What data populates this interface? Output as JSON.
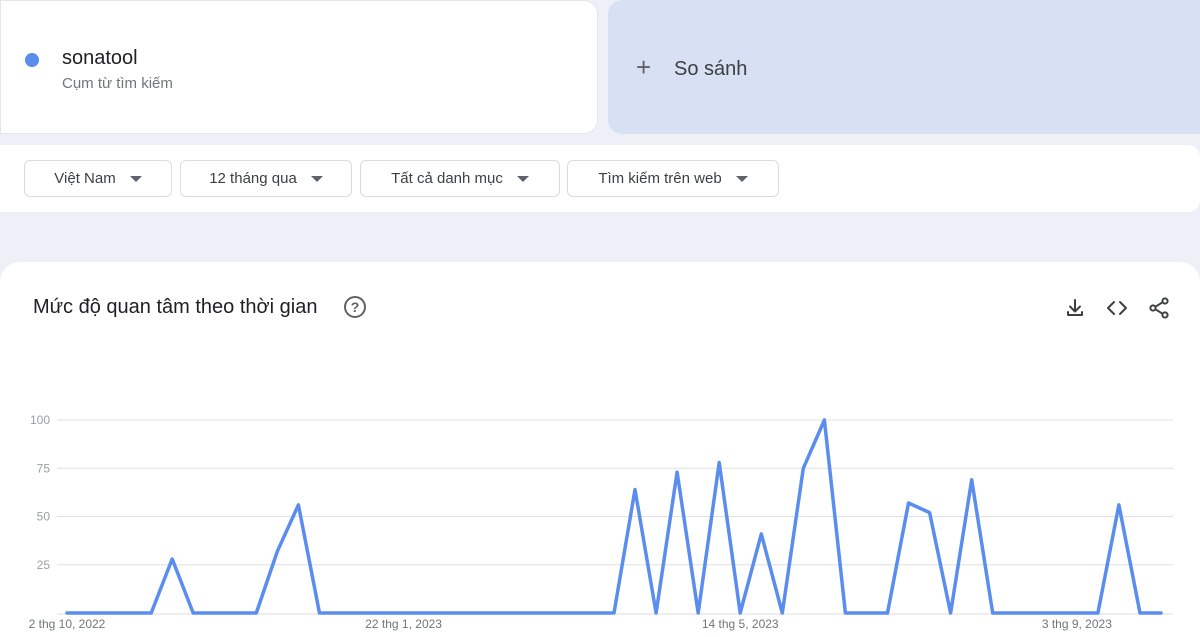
{
  "term": {
    "name": "sonatool",
    "type": "Cụm từ tìm kiếm",
    "color": "#5b8def"
  },
  "compare": {
    "label": "So sánh"
  },
  "filters": [
    {
      "label": "Việt Nam"
    },
    {
      "label": "12 tháng qua"
    },
    {
      "label": "Tất cả danh mục"
    },
    {
      "label": "Tìm kiếm trên web"
    }
  ],
  "chart_section": {
    "title": "Mức độ quan tâm theo thời gian",
    "icons": [
      "help-icon",
      "download-icon",
      "embed-code-icon",
      "share-icon"
    ]
  },
  "chart_data": {
    "type": "line",
    "ylim": [
      0,
      100
    ],
    "yticks": [
      25,
      50,
      75,
      100
    ],
    "grid": true,
    "x_tick_labels": [
      {
        "index": 0,
        "label": "2 thg 10, 2022"
      },
      {
        "index": 16,
        "label": "22 thg 1, 2023"
      },
      {
        "index": 32,
        "label": "14 thg 5, 2023"
      },
      {
        "index": 48,
        "label": "3 thg 9, 2023"
      }
    ],
    "series": [
      {
        "color": "#5b8def",
        "values": [
          0,
          0,
          0,
          0,
          0,
          28,
          0,
          0,
          0,
          0,
          32,
          56,
          0,
          0,
          0,
          0,
          0,
          0,
          0,
          0,
          0,
          0,
          0,
          0,
          0,
          0,
          0,
          64,
          0,
          73,
          0,
          78,
          0,
          41,
          0,
          75,
          100,
          0,
          0,
          0,
          57,
          52,
          0,
          69,
          0,
          0,
          0,
          0,
          0,
          0,
          56,
          0,
          0
        ]
      }
    ]
  }
}
